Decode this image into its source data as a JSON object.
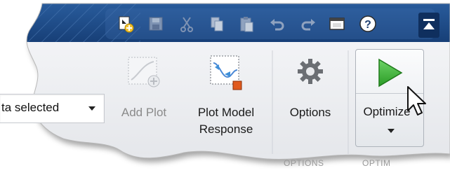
{
  "qat": {
    "items": [
      {
        "icon": "new-session-icon"
      },
      {
        "icon": "save-icon"
      },
      {
        "icon": "cut-icon"
      },
      {
        "icon": "copy-icon"
      },
      {
        "icon": "paste-icon"
      },
      {
        "icon": "undo-icon"
      },
      {
        "icon": "redo-icon"
      },
      {
        "icon": "window-icon"
      },
      {
        "icon": "help-icon"
      },
      {
        "icon": "minimize-ribbon-icon"
      }
    ]
  },
  "ribbon": {
    "data_dropdown": {
      "value": "ta selected"
    },
    "add_plot": {
      "label": "Add Plot"
    },
    "plot_model_response": {
      "line1": "Plot Model",
      "line2": "Response"
    },
    "options": {
      "label": "Options"
    },
    "optimize": {
      "label": "Optimize"
    },
    "sections": {
      "options": "OPTIONS",
      "optimize": "OPTIM"
    }
  },
  "colors": {
    "header_blue": "#1f4f8c",
    "ribbon_bg": "#eeeff1",
    "optimize_green": "#3fb53a"
  }
}
